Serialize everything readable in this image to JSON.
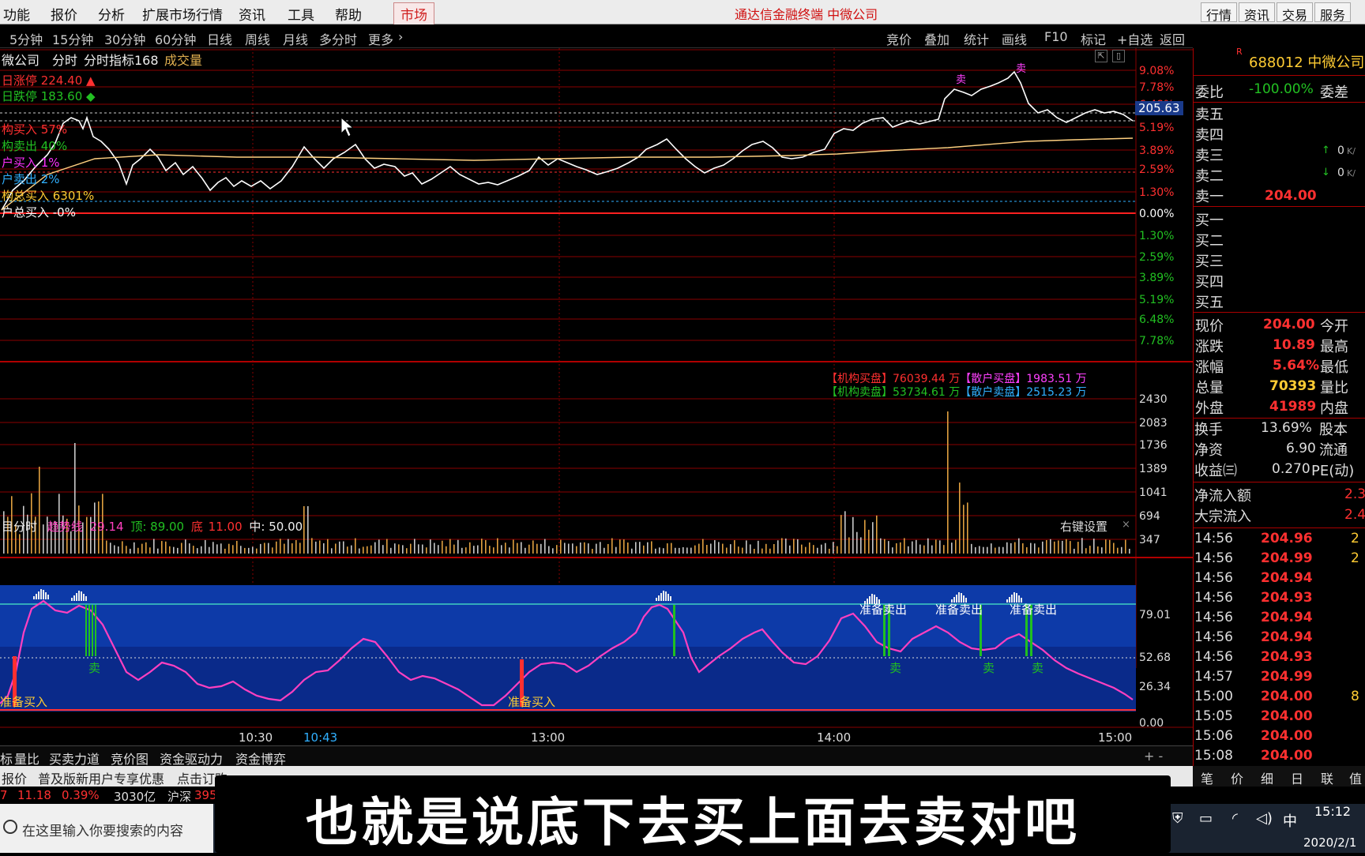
{
  "menu": {
    "items": [
      "功能",
      "报价",
      "分析",
      "扩展市场行情",
      "资讯",
      "工具",
      "帮助",
      "市场"
    ],
    "app_title": "通达信金融终端 中微公司",
    "right_buttons": [
      "行情",
      "资讯",
      "交易",
      "服务"
    ]
  },
  "toolbar": {
    "periods": [
      "5分钟",
      "15分钟",
      "30分钟",
      "60分钟",
      "日线",
      "周线",
      "月线",
      "多分时",
      "更多"
    ],
    "more_arrow": "›",
    "tools": [
      "竞价",
      "叠加",
      "统计",
      "画线",
      "F10",
      "标记",
      "+自选",
      "返回"
    ]
  },
  "chart": {
    "header": {
      "stock": "微公司",
      "label1": "分时",
      "label2": "分时指标168",
      "label3": "成交量"
    },
    "legend": [
      {
        "text": "日涨停 224.40 ▲",
        "color": "#ff3030"
      },
      {
        "text": "日跌停 183.60 ◆",
        "color": "#22c022"
      },
      {
        "text": "构买入 57%",
        "color": "#ff3030"
      },
      {
        "text": "构卖出 40%",
        "color": "#22c022"
      },
      {
        "text": "户买入 1%",
        "color": "#ff30ff"
      },
      {
        "text": "户卖出 2%",
        "color": "#30b0ff"
      },
      {
        "text": "构总买入 6301%",
        "color": "#ffcc33"
      },
      {
        "text": "户总买入 -0%",
        "color": "#ffffff"
      }
    ],
    "pct_up": [
      "9.08%",
      "7.78%",
      "6.48%",
      "5.19%",
      "3.89%",
      "2.59%",
      "1.30%"
    ],
    "pct_zero": "0.00%",
    "pct_down": [
      "1.30%",
      "2.59%",
      "3.89%",
      "5.19%",
      "6.48%",
      "7.78%"
    ],
    "cursor_price": "205.63",
    "flow1": {
      "a": "【机构买盘】",
      "b": "76039.44 万",
      "c": "【散户买盘】",
      "d": "1983.51 万"
    },
    "flow2": {
      "a": "【机构卖盘】",
      "b": "53734.61 万",
      "c": "【散户卖盘】",
      "d": "2515.23 万"
    },
    "vol_axis": [
      "2430",
      "2083",
      "1736",
      "1389",
      "1041",
      "694",
      "347"
    ],
    "indicator_header": {
      "a": "目分时",
      "b": "趋势线",
      "c": "29.14",
      "d": "顶: 89.00",
      "e": "底",
      "f": "11.00",
      "g": "中: 50.00",
      "settings": "右键设置"
    },
    "ind_axis": [
      "79.01",
      "52.68",
      "26.34",
      "0.00"
    ],
    "buy_label": "准备买入",
    "sell_label": "准备卖出",
    "sell_short": "卖",
    "sell_marker": "卖",
    "time_axis": [
      "10:30",
      "10:43",
      "13:00",
      "14:00",
      "15:00"
    ]
  },
  "right": {
    "title_mark": "R",
    "code": "688012 中微公司",
    "webi_label": "委比",
    "webi_val": "-100.00%",
    "weicha": "委差",
    "sells": [
      "卖五",
      "卖四",
      "卖三",
      "卖二",
      "卖一"
    ],
    "sell1_price": "204.00",
    "sell1_vol_a": "0",
    "sell1_vol_b": "0",
    "k_unit": "K/",
    "k_unit2": "K/",
    "buys": [
      "买一",
      "买二",
      "买三",
      "买四",
      "买五"
    ],
    "quotes": [
      {
        "l": "现价",
        "v": "204.00",
        "r": "今开"
      },
      {
        "l": "涨跌",
        "v": "10.89",
        "r": "最高"
      },
      {
        "l": "涨幅",
        "v": "5.64%",
        "r": "最低"
      },
      {
        "l": "总量",
        "v": "70393",
        "r": "量比"
      },
      {
        "l": "外盘",
        "v": "41989",
        "r": "内盘"
      }
    ],
    "quotes2": [
      {
        "l": "换手",
        "v": "13.69%",
        "r": "股本"
      },
      {
        "l": "净资",
        "v": "6.90",
        "r": "流通"
      },
      {
        "l": "收益㈢",
        "v": "0.270",
        "r": "PE(动)"
      }
    ],
    "flow": [
      {
        "l": "净流入额",
        "v": "2.3"
      },
      {
        "l": "大宗流入",
        "v": "2.4"
      }
    ],
    "ticks": [
      {
        "t": "14:56",
        "p": "204.96",
        "x": "2"
      },
      {
        "t": "14:56",
        "p": "204.99",
        "x": "2"
      },
      {
        "t": "14:56",
        "p": "204.94",
        "x": ""
      },
      {
        "t": "14:56",
        "p": "204.93",
        "x": ""
      },
      {
        "t": "14:56",
        "p": "204.94",
        "x": ""
      },
      {
        "t": "14:56",
        "p": "204.94",
        "x": ""
      },
      {
        "t": "14:56",
        "p": "204.93",
        "x": ""
      },
      {
        "t": "14:57",
        "p": "204.99",
        "x": ""
      },
      {
        "t": "15:00",
        "p": "204.00",
        "x": "8"
      },
      {
        "t": "15:05",
        "p": "204.00",
        "x": ""
      },
      {
        "t": "15:06",
        "p": "204.00",
        "x": ""
      },
      {
        "t": "15:08",
        "p": "204.00",
        "x": ""
      }
    ],
    "bottom_tabs": [
      "笔",
      "价",
      "细",
      "日",
      "联",
      "值"
    ]
  },
  "bottom_tabs": [
    "标",
    "量比",
    "买卖力道",
    "竞价图",
    "资金驱动力",
    "资金博弈"
  ],
  "plusminus": "+  -",
  "promo": {
    "a": "报价",
    "b": "普及版新用户专享优惠",
    "c": "点击订购"
  },
  "status": {
    "a": "7",
    "b": "11.18",
    "c": "0.39%",
    "d": "3030亿",
    "e": "沪深",
    "f": "395"
  },
  "taskbar": {
    "search": "在这里输入你要搜索的内容",
    "ime": "中",
    "time": "15:12",
    "date": "2020/2/1"
  },
  "subtitle": "也就是说底下去买上面去卖对吧",
  "colors": {
    "up": "#ff3030",
    "down": "#22c022",
    "price_line": "#ffffff",
    "avg_line": "#ffd080",
    "indicator_line": "#ff40c0",
    "indicator_bg": "#0a2a8a",
    "grid": "#8a0000"
  }
}
